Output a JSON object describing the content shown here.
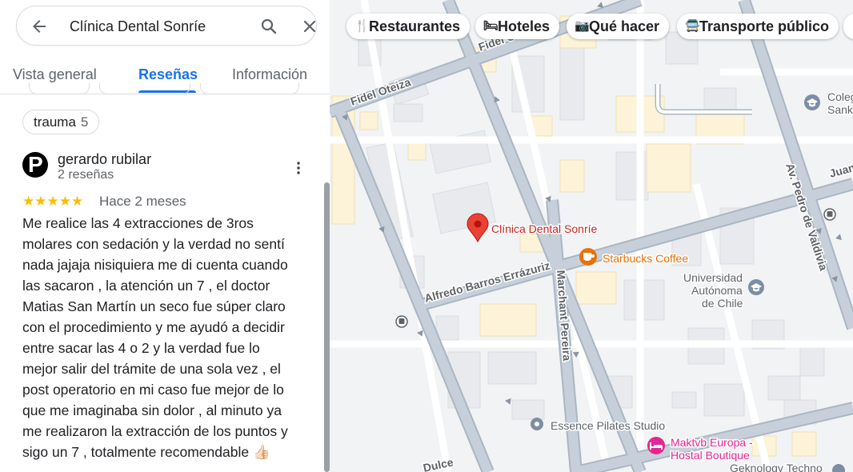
{
  "search": {
    "query": "Clínica Dental Sonríe"
  },
  "tabs": [
    {
      "label": "Vista general"
    },
    {
      "label": "Reseñas"
    },
    {
      "label": "Información"
    }
  ],
  "topic_chip": {
    "label": "trauma",
    "count": "5"
  },
  "review": {
    "author": "gerardo rubilar",
    "author_meta": "2 reseñas",
    "avatar_letter": "P",
    "rating": 5,
    "stars_glyphs": "★★★★★",
    "when": "Hace 2 meses",
    "lines": [
      "Me realice las 4 extracciones de 3ros",
      "molares con sedación y la verdad no sentí",
      "nada jajaja nisiquiera me di cuenta cuando",
      "las sacaron , la atención un 7 , el doctor",
      "Matias San Martín un seco fue súper claro",
      "con el procedimiento y me ayudó a decidir",
      "entre sacar las 4 o 2 y la verdad fue lo",
      "mejor salir del trámite de una sola vez , el",
      "post operatorio en mi caso fue mejor de lo",
      "que me imaginaba sin dolor , al minuto ya",
      "me realizaron la extracción de los puntos y",
      "sigo un 7 , totalmente recomendable 👍🏻"
    ]
  },
  "map": {
    "chips": [
      {
        "label": "Restaurantes",
        "icon": "fork-knife-icon"
      },
      {
        "label": "Hoteles",
        "icon": "bed-icon"
      },
      {
        "label": "Qué hacer",
        "icon": "camera-icon"
      },
      {
        "label": "Transporte público",
        "icon": "bus-icon"
      }
    ],
    "streets": {
      "fidel_top": "Fidel Oteiza",
      "fidel_left": "Fidel Oteiza",
      "alfredo": "Alfredo Barros Errázuriz",
      "marchant": "Marchant Pereira",
      "pedro": "Av. Pedro de Valdivia",
      "juan": "Juan",
      "dulce": "Dulce"
    },
    "places": {
      "clinic": "Clínica Dental Sonríe",
      "starbucks": "Starbucks Coffee",
      "universidad_1": "Universidad",
      "universidad_2": "Autónoma",
      "universidad_3": "de Chile",
      "colegio_1": "Coleg",
      "colegio_2": "Sankt",
      "essence": "Essence Pilates Studio",
      "maktvb_1": "Maktvb Europa -",
      "maktvb_2": "Hostal Boutique",
      "geknology": "Geknology Techno"
    },
    "colors": {
      "background": "#f1f3f4",
      "road": "#ffffff",
      "main_road": "#aab6c3",
      "building": "#e8eaed",
      "building_yellow": "#fdf3d8",
      "pin": "#ea4335",
      "clinic_label": "#c5221f",
      "cafe": "#e8710a",
      "lodging": "#e52592",
      "school": "#7b8ea3"
    }
  }
}
